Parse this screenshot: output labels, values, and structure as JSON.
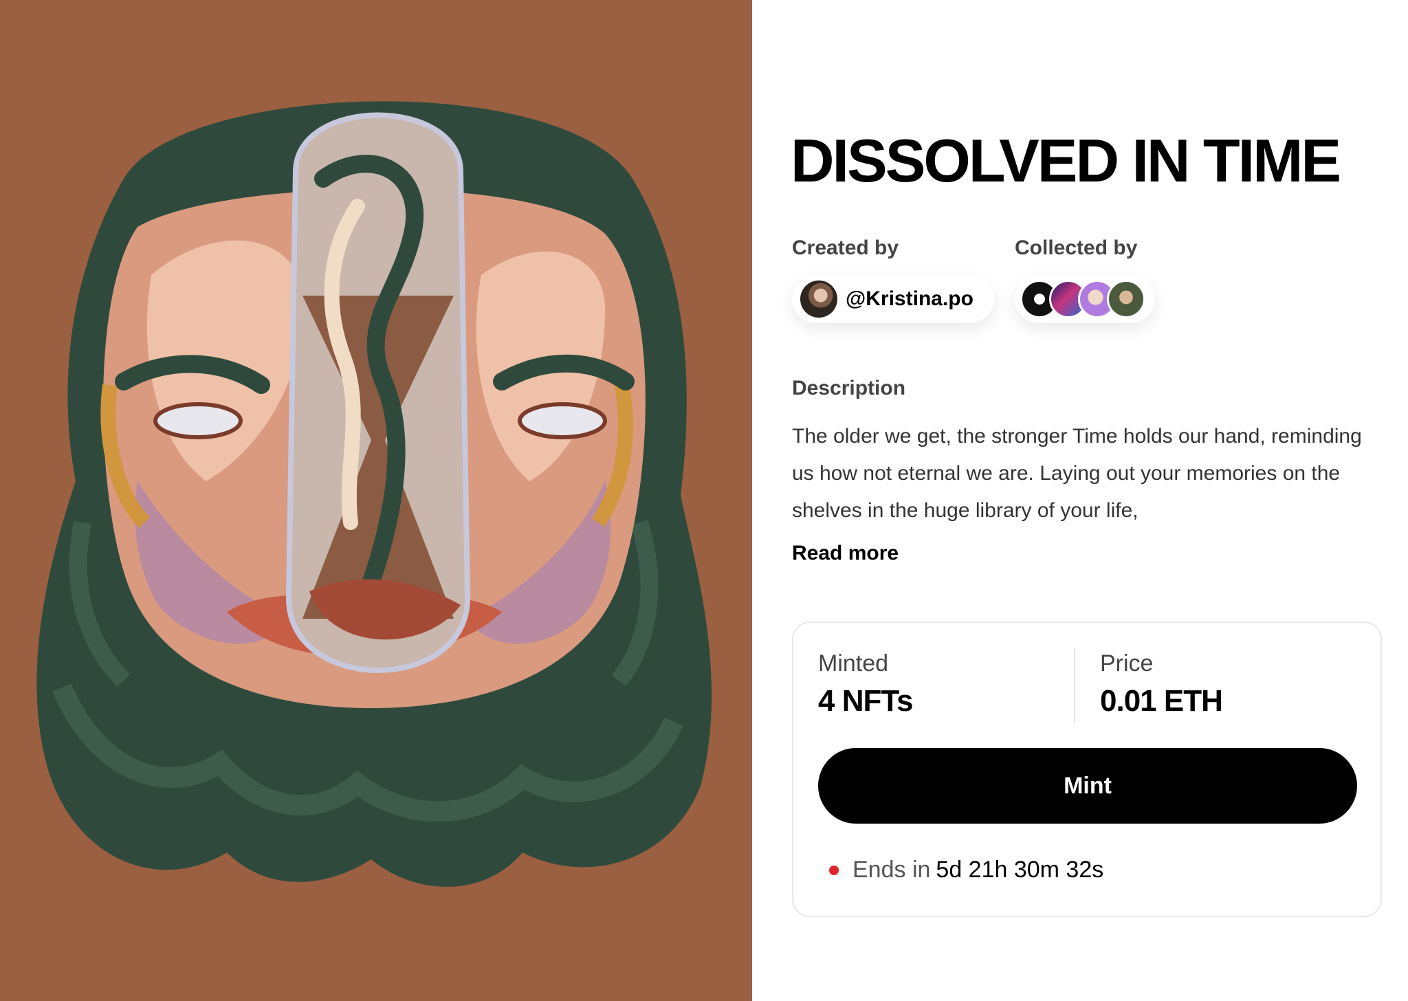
{
  "nft": {
    "title": "DISSOLVED IN TIME",
    "created_label": "Created by",
    "creator_handle": "@Kristina.po",
    "collected_label": "Collected by",
    "collectors": [
      "collector-1",
      "collector-2",
      "collector-3",
      "collector-4"
    ],
    "description_label": "Description",
    "description": "The older we get, the stronger Time holds our hand, reminding us how not eternal we are. Laying out your memories on the shelves in the huge library of your life,",
    "read_more": "Read more"
  },
  "mint": {
    "minted_label": "Minted",
    "minted_value": "4 NFTs",
    "price_label": "Price",
    "price_value": "0.01 ETH",
    "button_label": "Mint",
    "ends_label": "Ends in",
    "ends_value": "5d 21h 30m 32s",
    "status_color": "#e0242b"
  },
  "colors": {
    "artwork_background": "#9b5f42",
    "hair": "#2f4a3c",
    "button": "#000000"
  }
}
